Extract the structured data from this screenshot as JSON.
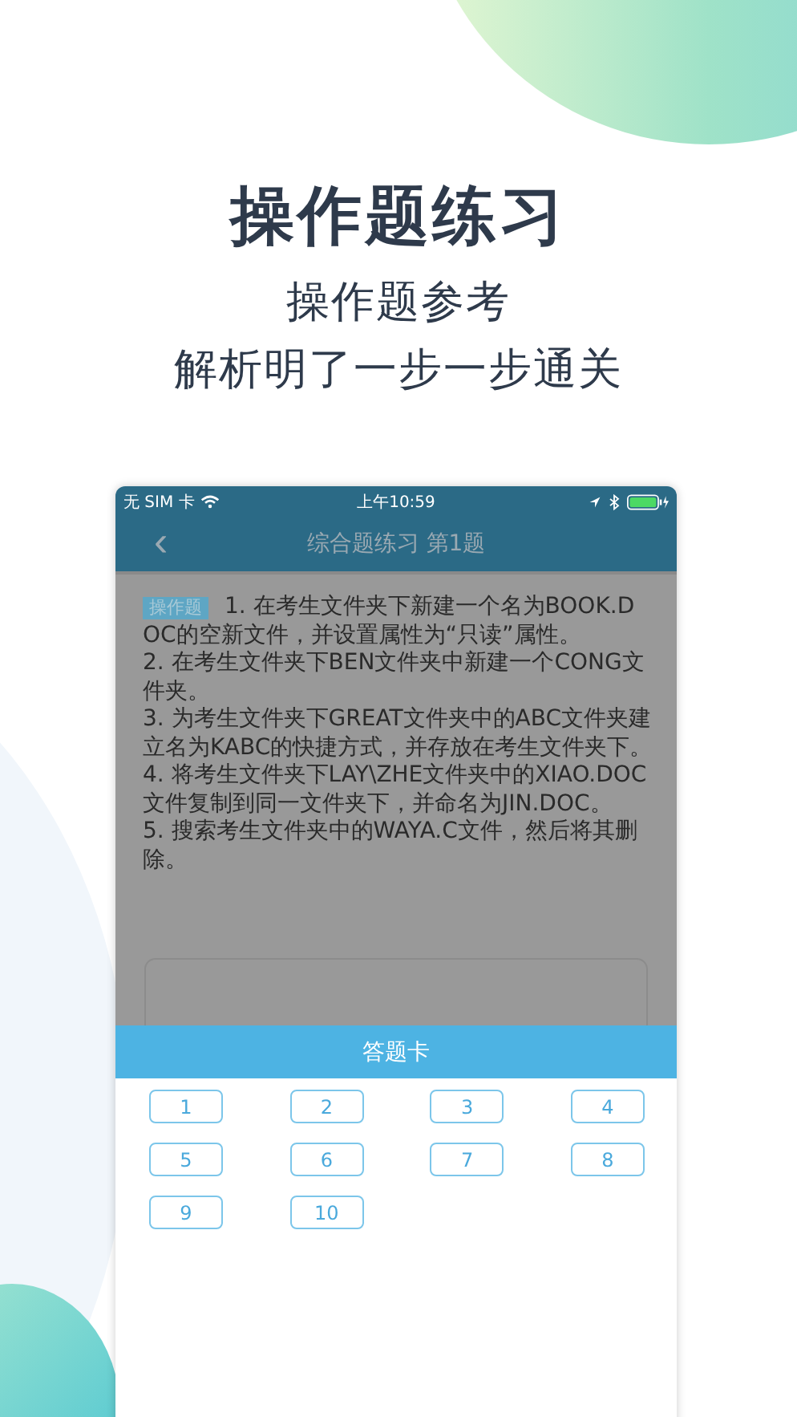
{
  "headline": "操作题练习",
  "subtitles": [
    "操作题参考",
    "解析明了一步一步通关"
  ],
  "status_bar": {
    "carrier": "无 SIM 卡",
    "time": "上午10:59"
  },
  "nav": {
    "back": "‹",
    "title": "综合题练习 第1题"
  },
  "question": {
    "tag": "操作题",
    "first_line": "1. 在考生文件夹下新建一个名为BOOK.D",
    "lines": [
      "OC的空新文件，并设置属性为“只读”属性。",
      "2. 在考生文件夹下BEN文件夹中新建一个CONG文件夹。",
      "3. 为考生文件夹下GREAT文件夹中的ABC文件夹建立名为KABC的快捷方式，并存放在考生文件夹下。",
      "4. 将考生文件夹下LAY\\ZHE文件夹中的XIAO.DOC文件复制到同一文件夹下，并命名为JIN.DOC。",
      "5.  搜索考生文件夹中的WAYA.C文件，然后将其删除。"
    ]
  },
  "answer_card": {
    "title": "答题卡",
    "numbers": [
      "1",
      "2",
      "3",
      "4",
      "5",
      "6",
      "7",
      "8",
      "9",
      "10"
    ]
  }
}
